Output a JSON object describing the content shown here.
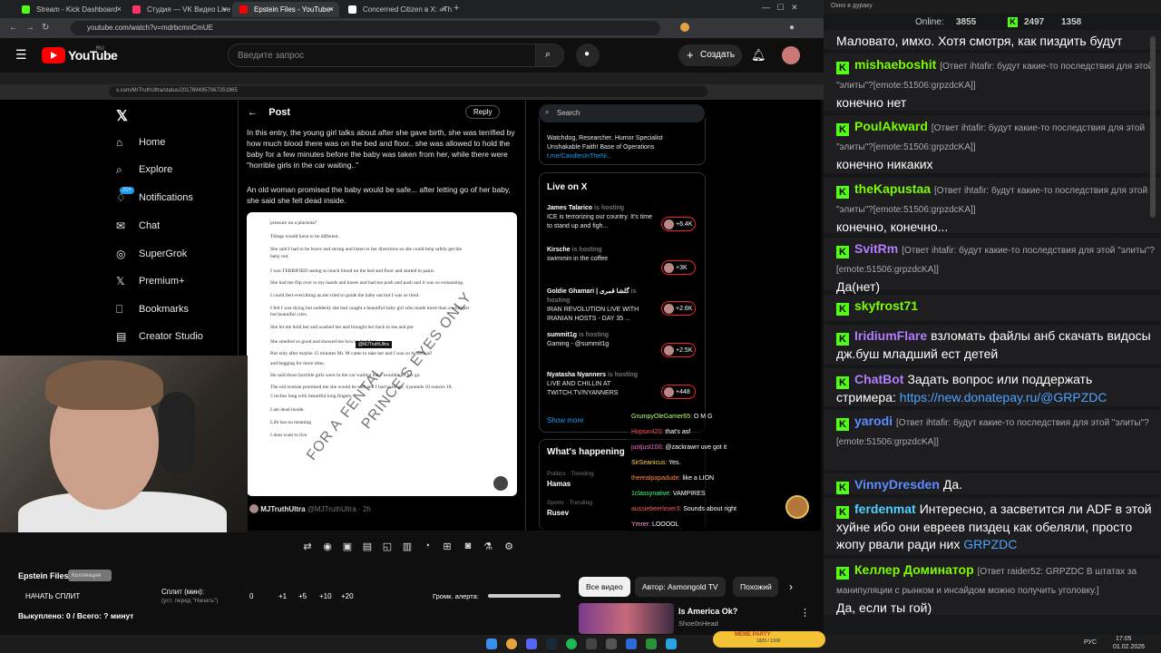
{
  "tabs": [
    {
      "title": "Stream - Kick Dashboard",
      "color": "#53fc18"
    },
    {
      "title": "Студия — VK Видео Live",
      "color": "#ff3366"
    },
    {
      "title": "Epstein Files - YouTube",
      "color": "#ff0000"
    },
    {
      "title": "Concerned Citizen в X: «They",
      "color": "#ffffff"
    }
  ],
  "address": "youtube.com/watch?v=mdrbcmnCmUE",
  "yt": {
    "brand": "YouTube",
    "region": "RU",
    "search_placeholder": "Введите запрос",
    "create": "Создать"
  },
  "inner_address": "x.com/MrTruthUltra/status/2017694957067251965",
  "x": {
    "nav": [
      "Home",
      "Explore",
      "Notifications",
      "Chat",
      "SuperGrok",
      "Premium+",
      "Bookmarks",
      "Creator Studio"
    ],
    "notif_badge": "20+",
    "post_title": "Post",
    "reply": "Reply",
    "p1": "In this entry, the young girl talks about after she gave birth, she was terrified by how much blood there was on the bed and floor.. she was allowed to hold the baby for a few minutes before the baby was taken from her, while there were \"horrible girls in the car waiting..\"",
    "p2": "An old woman promised the baby would be safe... after letting go of her baby, she said she felt dead inside.",
    "doc_lines": [
      "pressure on a placenta?",
      "Things would have to be different.",
      "She said I had to be brave and strong and listen to her directions so she could help safely get the",
      "baby out.",
      "I was TERRIFIED seeing so much blood on the bed and floor and started to panic.",
      "She had me flip over to my hands and knees and had me push and push and it was so exhausting.",
      "I could feel everything as she tried to guide the baby out but I was so tired.",
      "I felt I was dying but suddenly she had caught a beautiful baby girl who made more than a whimper",
      "but beautiful cries.",
      "She let me hold her and washed her and brought her back to me and put",
      "She smelled so good and showed me how to feed her",
      "But only after maybe 15 minutes Mr. M came to take her and I was so hysterical!",
      "and begging for more time.",
      "He said those horrible girls were in the car waiting but I wouldnt let her go.",
      "The old woman promised me she would be safe and I had to let go. 4 pounds 10 ounces 18.",
      "5 inches long with beautiful long fingers.",
      "I am dead inside.",
      "Life has no meaning",
      "I dont want to live"
    ],
    "doc_tag": "@MJTruthUltra",
    "watermark": [
      "FOR A",
      "FENTAL",
      "PRINCE'S EYES ONLY"
    ],
    "author": "MJTruthUltra",
    "handle": "@MJTruthUltra · 2h",
    "search": "Search",
    "bio": "Watchdog, Researcher, Humor Specialist Unshakable Faith! Base of Operations",
    "bio_link": "t.me/CandlesInTheNi...",
    "live_title": "Live on X",
    "live": [
      {
        "name": "James Talarico",
        "tag": "is hosting",
        "text": "ICE is terrorizing our country. It's time to stand up and figh...",
        "count": "+6.4K"
      },
      {
        "name": "Kirsche",
        "tag": "is hosting",
        "text": "swimmin in the coffee",
        "count": "+3K"
      },
      {
        "name": "Goldie Ghamari | گلشا قمری",
        "tag": "is hosting",
        "text": "IRAN REVOLUTION LIVE WITH IRANIAN HOSTS - DAY 35 ...",
        "count": "+2.6K"
      },
      {
        "name": "summit1g",
        "tag": "is hosting",
        "text": "Gaming - @summit1g",
        "count": "+2.5K"
      },
      {
        "name": "Nyatasha Nyanners",
        "tag": "is hosting",
        "text": "LIVE AND CHILLIN AT TWITCH.TV/NYANNERS",
        "count": "+448"
      }
    ],
    "show_more": "Show more",
    "happening": "What's happening",
    "trends": [
      {
        "cat": "Politics · Trending",
        "name": "Hamas"
      },
      {
        "cat": "Sports · Trending",
        "name": "Rusev"
      }
    ]
  },
  "overlay_chat": [
    {
      "user": "GrumpyOleGamer65:",
      "text": "O M G",
      "color": "#b8ff6b"
    },
    {
      "user": "Hopsin420:",
      "text": "that's       asf",
      "color": "#ff4d4d"
    },
    {
      "user": "justjust100:",
      "text": "@zackrawrr uve got it",
      "color": "#ff6bd5"
    },
    {
      "user": "SirSeanicus:",
      "text": "Yes.",
      "color": "#ffd24d"
    },
    {
      "user": "therealpapadude:",
      "text": "like a LION",
      "color": "#ff8c3a"
    },
    {
      "user": "1classynative:",
      "text": "VAMPIRES",
      "color": "#4dff88"
    },
    {
      "user": "aussiebeerlover3:",
      "text": "Sounds about right",
      "color": "#ff5a5a"
    },
    {
      "user": "Ymrer:",
      "text": "LOOOOL",
      "color": "#ff9ad5"
    }
  ],
  "panel": {
    "title": "Epstein Files",
    "badge": "Коллекция",
    "split_btn": "НАЧАТЬ СПЛИТ",
    "split_label": "Сплит (мин):",
    "split_hint": "(уст. перед \"Начать\")",
    "split_vals": [
      "0",
      "+1",
      "+5",
      "+10",
      "+20"
    ],
    "alert": "Громк. алерта:",
    "bought": "Выкуплено: 0 / Всего: ? минут"
  },
  "chips": [
    {
      "label": "Все видео"
    },
    {
      "label": "Автор: Asmongold TV"
    },
    {
      "label": "Похожий"
    }
  ],
  "rec": {
    "title": "Is America Ok?",
    "channel": "Shoe0nHead"
  },
  "rchat": {
    "window": "Окно в дураку",
    "online_label": "Online:",
    "online": "3855",
    "kick": "2497",
    "vk": "1358",
    "messages": [
      {
        "user": "",
        "reply": "",
        "text": "Маловато, имхо. Хотя смотря, как пиздить будут",
        "color": "#fff"
      },
      {
        "user": "mishaeboshit",
        "reply": "[Ответ ihtafir: будут какие-то последствия для этой \"элиты\"?[emote:51506:grpzdcKA]]",
        "text": "конечно нет",
        "color": "#7cfc00"
      },
      {
        "user": "PoulAkward",
        "reply": "[Ответ ihtafir: будут какие-то последствия для этой \"элиты\"?[emote:51506:grpzdcKA]]",
        "text": "конечно никаких",
        "color": "#7cfc00"
      },
      {
        "user": "theKapustaa",
        "reply": "[Ответ ihtafir: будут какие-то последствия для этой \"элиты\"?[emote:51506:grpzdcKA]]",
        "text": "конечно, конечно...",
        "color": "#7cfc00"
      },
      {
        "user": "SvitRm",
        "reply": "[Ответ ihtafir: будут какие-то последствия для этой \"элиты\"?[emote:51506:grpzdcKA]]",
        "text": "Да(нет)",
        "color": "#b47cff"
      },
      {
        "user": "skyfrost71",
        "reply": "",
        "text": "",
        "color": "#7cfc00"
      },
      {
        "user": "IridiumFlare",
        "reply": "",
        "text": "взломать файлы анб скачать видосы дж.буш младший ест детей",
        "color": "#b47cff"
      },
      {
        "user": "ChatBot",
        "reply": "",
        "text": "Задать вопрос или поддержать стримера: ",
        "link": "https://new.donatepay.ru/@GRPZDC",
        "color": "#b47cff"
      },
      {
        "user": "yarodi",
        "reply": "[Ответ ihtafir: будут какие-то последствия для этой \"элиты\"?[emote:51506:grpzdcKA]]",
        "text": "",
        "color": "#5c8cff"
      },
      {
        "user": "VinnyDresden",
        "reply": "",
        "text": "Да.",
        "color": "#5c8cff"
      },
      {
        "user": "ferdenmat",
        "reply": "",
        "text": "Интересно, а засветится ли ADF в этой хуйне ибо они евреев пиздец как обеляли, просто жопу рвали ради них ",
        "link": "GRPZDC",
        "color": "#4dd2ff"
      },
      {
        "user": "Келлер Доминатор",
        "reply": "[Ответ raider52: GRPZDC В штатах за манипуляции с рынком и инсайдом можно получить уголовку.]",
        "text": "Да, если ты гой)",
        "color": "#7cfc00"
      }
    ]
  },
  "clock": {
    "time": "17:05",
    "date": "01.02.2026",
    "lang": "РУС"
  },
  "meme_party": "MEME PARTY",
  "meme_count": "1825 / 1500"
}
